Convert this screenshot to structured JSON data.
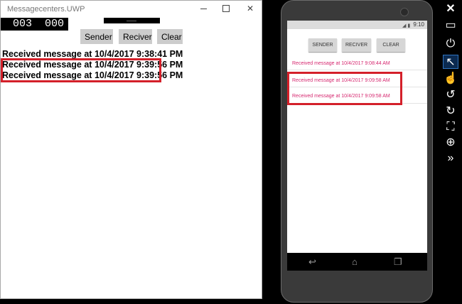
{
  "uwp": {
    "title": "Messagecenters.UWP",
    "framerate_a": "003",
    "framerate_b": "000",
    "buttons": {
      "sender": "Sender",
      "reciver": "Reciver",
      "clear": "Clear"
    },
    "messages": [
      "Received message at 10/4/2017 9:38:41 PM",
      "Received message at 10/4/2017 9:39:56 PM",
      "Received message at 10/4/2017 9:39:56 PM"
    ]
  },
  "phone": {
    "clock": "9:10",
    "buttons": {
      "sender": "SENDER",
      "reciver": "RECIVER",
      "clear": "CLEAR"
    },
    "messages": [
      "Received message at 10/4/2017 9:08:44 AM",
      "Received message at 10/4/2017 9:09:58 AM",
      "Received message at 10/4/2017 9:09:58 AM"
    ],
    "message_color": "#d6276f"
  },
  "highlight_color": "#d4202a",
  "toolbar_icons": [
    "close-icon",
    "minimize-icon",
    "power-icon",
    "pointer-icon",
    "touch-icon",
    "rotate-left-icon",
    "rotate-right-icon",
    "fit-screen-icon",
    "zoom-icon",
    "more-icon"
  ]
}
